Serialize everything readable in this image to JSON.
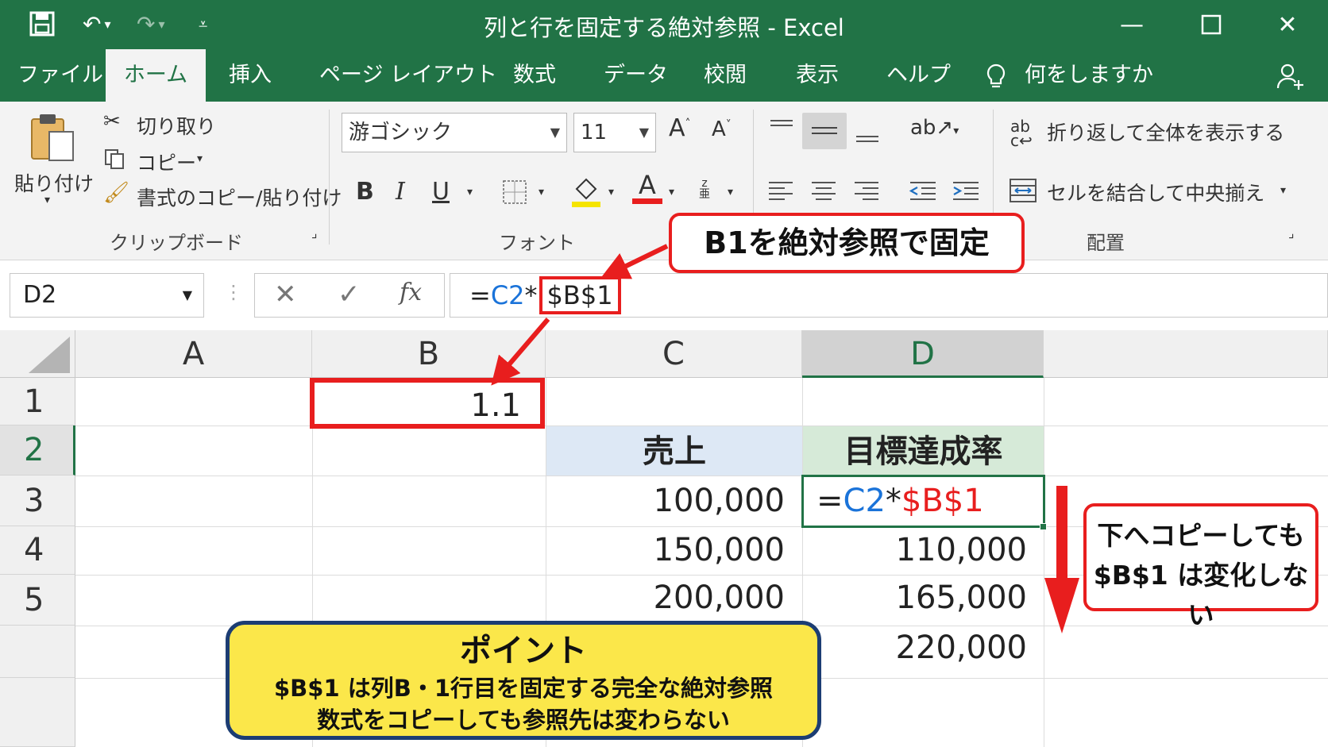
{
  "titlebar": {
    "title": "列と行を固定する絶対参照  - Excel",
    "save_icon": "save-icon",
    "undo_icon": "undo-icon",
    "redo_icon": "redo-icon",
    "customize_icon": "customize-qat-icon"
  },
  "menu": {
    "tabs": [
      "ファイル",
      "ホーム",
      "挿入",
      "ページ レイアウト",
      "数式",
      "データ",
      "校閲",
      "表示",
      "ヘルプ"
    ],
    "active_tab": "ホーム",
    "tell_me": "何をしますか"
  },
  "ribbon": {
    "clipboard": {
      "paste": "貼り付け",
      "cut": "切り取り",
      "copy": "コピー",
      "format_painter": "書式のコピー/貼り付け",
      "label": "クリップボード"
    },
    "font": {
      "font_name": "游ゴシック",
      "font_size": "11",
      "bold": "B",
      "italic": "I",
      "underline": "U",
      "label": "フォント",
      "highlight_color": "#f5e400",
      "font_color": "#e81e1e"
    },
    "alignment": {
      "wrap_text": "折り返して全体を表示する",
      "merge_center": "セルを結合して中央揃え",
      "label": "配置"
    }
  },
  "formula_bar": {
    "name_box": "D2",
    "fx": "fx",
    "formula_prefix": "=",
    "formula_ref": "C2",
    "formula_op": "*",
    "formula_abs": "$B$1"
  },
  "grid": {
    "columns": [
      "A",
      "B",
      "C",
      "D"
    ],
    "rows": [
      "1",
      "2",
      "3",
      "4",
      "5"
    ],
    "selected_column": "D",
    "selected_row": "2",
    "cells": {
      "B1": "1.1",
      "C2": "売上",
      "D2": "目標達成率",
      "C3": "100,000",
      "C4": "150,000",
      "C5": "200,000",
      "D3_prefix": "=",
      "D3_ref": "C2",
      "D3_op": "*",
      "D3_abs": "$B$1",
      "D4": "110,000",
      "D5": "165,000",
      "D6": "220,000"
    }
  },
  "annotations": {
    "fix_callout": "B1を絶対参照で固定",
    "copy_note_line1": "下へコピーしても",
    "copy_note_line2": "$B$1 は変化しない",
    "point_title": "ポイント",
    "point_line1": "$B$1 は列B・1行目を固定する完全な絶対参照",
    "point_line2": "数式をコピーしても参照先は変わらない"
  },
  "colors": {
    "excel_green": "#217346",
    "accent_red": "#e81e1e",
    "ref_blue": "#1a73d9",
    "sales_header_bg": "#dde8f5",
    "target_header_bg": "#d6ead8",
    "point_bg": "#fbe74a",
    "point_border": "#1c3d73"
  }
}
